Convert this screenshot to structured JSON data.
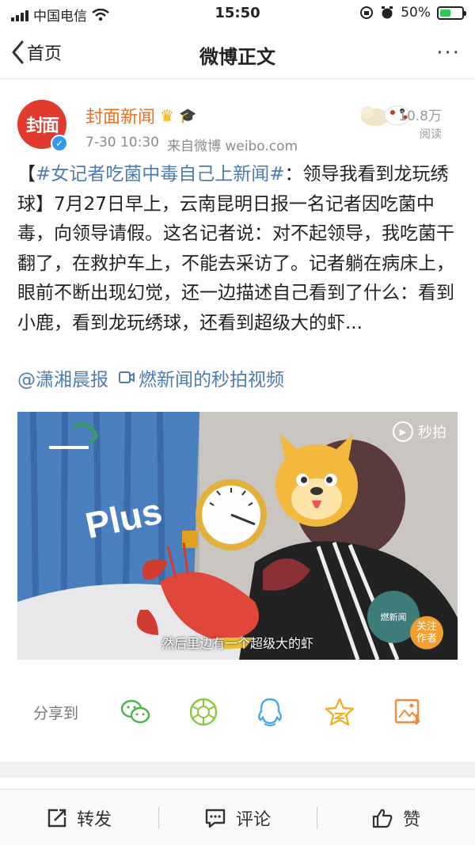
{
  "status_bar": {
    "carrier": "中国电信",
    "time": "15:50",
    "battery": "50%",
    "battery_level": 0.5
  },
  "nav": {
    "back_label": "首页",
    "title": "微博正文",
    "more": "···"
  },
  "post": {
    "author": {
      "avatar_text": "封面",
      "name": "封面新闻"
    },
    "date": "7-30 10:30",
    "source": "来自微博 weibo.com",
    "read_count": "10.8万",
    "read_label": "阅读",
    "text": {
      "bracket_open": "【",
      "topic": "#女记者吃菌中毒自己上新闻#",
      "body": "：领导我看到龙玩绣球】7月27日早上，云南昆明日报一名记者因吃菌中毒，向领导请假。这名记者说：对不起领导，我吃菌干翻了，在救护车上，不能去采访了。记者躺在病床上，眼前不断出现幻觉，还一边描述自己看到了什么：看到小鹿，看到龙玩绣球，还看到超级大的虾..."
    },
    "mention": "@潇湘晨报",
    "video_link": "燃新闻的秒拍视频"
  },
  "video": {
    "brand": "秒拍",
    "subtitle": "然后里边有一个超级大的虾",
    "curtain_text": "Plus",
    "source_logo": "燃新闻",
    "follow_label": "关注\n作者"
  },
  "share": {
    "label": "分享到",
    "targets": [
      "wechat-icon",
      "moments-icon",
      "qq-icon",
      "qzone-icon",
      "save-image-icon"
    ]
  },
  "cut_text": "",
  "toolbar": {
    "repost": "转发",
    "comment": "评论",
    "like": "赞"
  }
}
